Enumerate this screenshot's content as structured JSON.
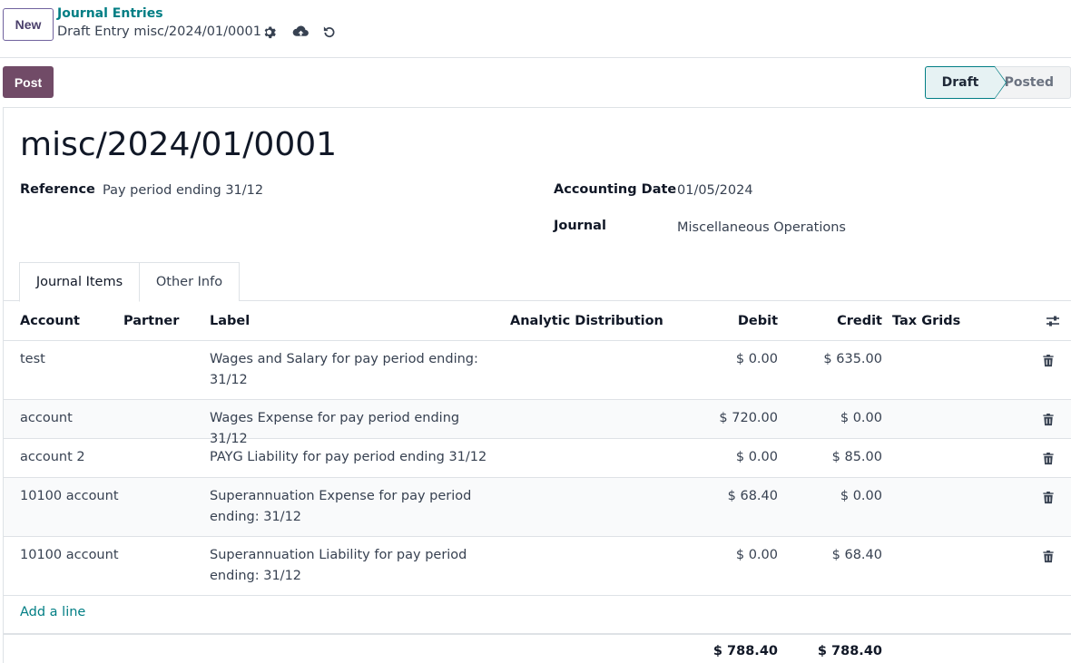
{
  "control_panel": {
    "new_label": "New",
    "breadcrumb": "Journal Entries",
    "record_title": "Draft Entry misc/2024/01/0001"
  },
  "actions": {
    "post_label": "Post"
  },
  "statusbar": {
    "draft": "Draft",
    "posted": "Posted",
    "active": "Draft"
  },
  "entry": {
    "name": "misc/2024/01/0001",
    "reference_label": "Reference",
    "reference_value": "Pay period ending 31/12",
    "accounting_date_label": "Accounting Date",
    "accounting_date_value": "01/05/2024",
    "journal_label": "Journal",
    "journal_value": "Miscellaneous Operations"
  },
  "tabs": [
    {
      "label": "Journal Items",
      "active": true
    },
    {
      "label": "Other Info",
      "active": false
    }
  ],
  "table": {
    "headers": {
      "account": "Account",
      "partner": "Partner",
      "label": "Label",
      "analytic": "Analytic Distribution",
      "debit": "Debit",
      "credit": "Credit",
      "tax_grids": "Tax Grids"
    },
    "rows": [
      {
        "account": "test",
        "partner": "",
        "label_line1": "Wages and Salary for pay period ending:",
        "label_line2": "31/12",
        "debit": "$ 0.00",
        "credit": "$ 635.00"
      },
      {
        "account": "account",
        "partner": "",
        "label_line1": "Wages Expense for pay period ending 31/12",
        "label_line2": "",
        "debit": "$ 720.00",
        "credit": "$ 0.00"
      },
      {
        "account": "account 2",
        "partner": "",
        "label_line1": "PAYG Liability for pay period ending 31/12",
        "label_line2": "",
        "debit": "$ 0.00",
        "credit": "$ 85.00"
      },
      {
        "account": "10100 account",
        "partner": "",
        "label_line1": "Superannuation Expense for pay period",
        "label_line2": "ending: 31/12",
        "debit": "$ 68.40",
        "credit": "$ 0.00"
      },
      {
        "account": "10100 account",
        "partner": "",
        "label_line1": "Superannuation Liability for pay period",
        "label_line2": "ending: 31/12",
        "debit": "$ 0.00",
        "credit": "$ 68.40"
      }
    ],
    "add_line_label": "Add a line",
    "total_debit": "$ 788.40",
    "total_credit": "$ 788.40"
  },
  "icons": {
    "gear": "gear-icon",
    "save": "cloud-upload-icon",
    "discard": "undo-icon",
    "column_options": "sliders-icon",
    "delete": "trash-icon"
  },
  "colors": {
    "primary": "#714b67",
    "link": "#017e84",
    "active_status_bg": "#e6f2f3"
  }
}
